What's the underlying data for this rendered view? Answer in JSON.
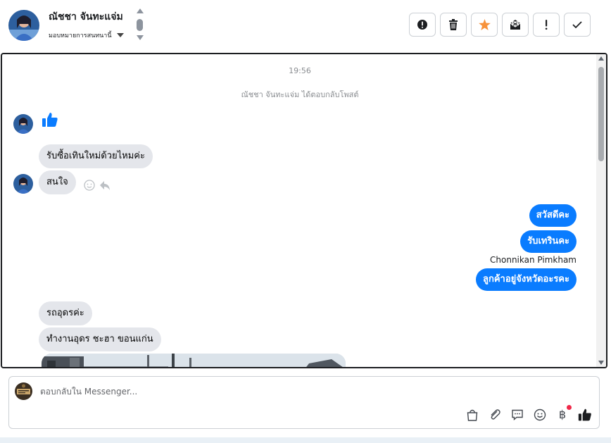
{
  "header": {
    "contact_name": "ณัชชา จันทะแจ่ม",
    "assign_label": "มอบหมายการสนทนานี้",
    "actions": [
      {
        "name": "report-spam-button",
        "icon": "alert-circle-icon"
      },
      {
        "name": "delete-button",
        "icon": "trash-icon"
      },
      {
        "name": "star-button",
        "icon": "star-icon"
      },
      {
        "name": "mark-unread-button",
        "icon": "envelope-open-icon"
      },
      {
        "name": "mark-important-button",
        "icon": "exclamation-icon"
      },
      {
        "name": "mark-done-button",
        "icon": "check-icon"
      }
    ]
  },
  "thread": {
    "timestamp": "19:56",
    "reply_note": "ณัชชา จันทะแจ่ม ได้ตอบกลับโพสต์",
    "incoming": [
      "รับซื้อเทินใหม่ด้วยไหมค่ะ",
      "สนใจ",
      "รถอุดรค่ะ",
      "ทำงานอุดร ชะฮา ขอนแก่น"
    ],
    "outgoing": [
      "สวัสดีคะ",
      "รับเทรินคะ",
      "ลูกค้าอยู่จังหวัดอะรคะ"
    ],
    "sender_name": "Chonnikan Pimkham"
  },
  "composer": {
    "placeholder": "ตอบกลับใน Messenger..."
  },
  "colors": {
    "outgoing_bubble": "#0a7cff",
    "incoming_bubble": "#e4e6eb",
    "star": "#f7923b",
    "notification_dot": "#f02849"
  }
}
